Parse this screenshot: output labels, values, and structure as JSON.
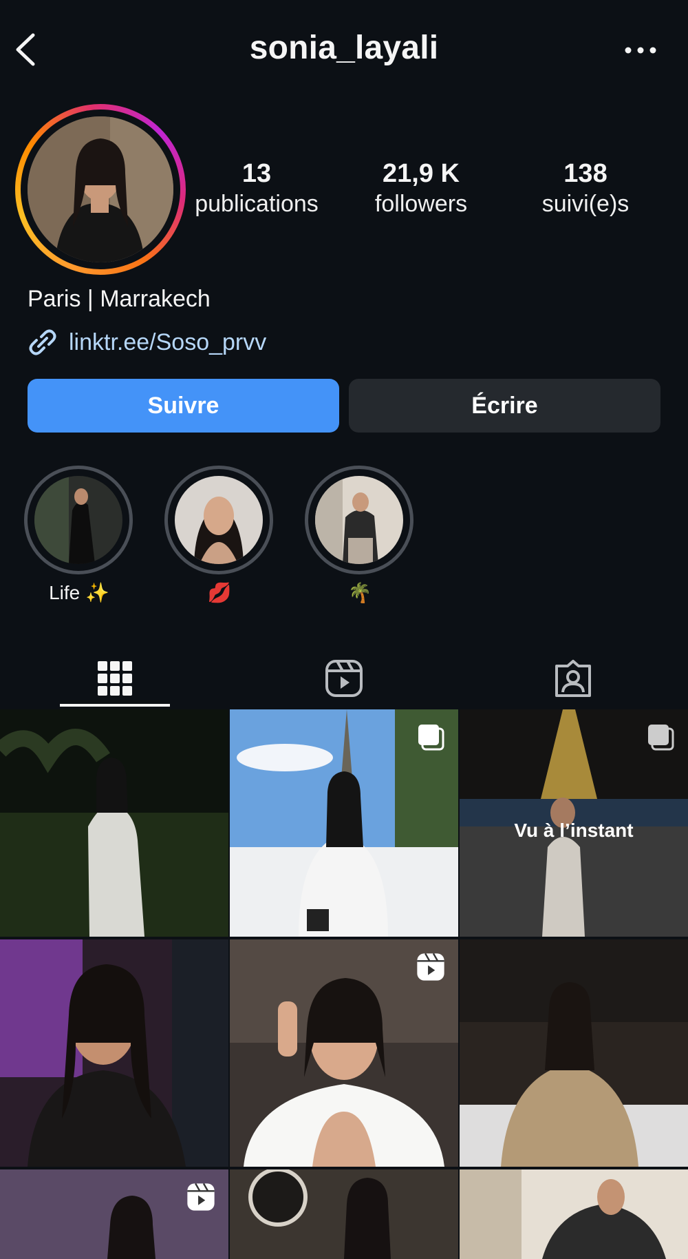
{
  "header": {
    "username": "sonia_layali",
    "back_icon": "chevron-left-icon",
    "more_icon": "ellipsis-icon"
  },
  "profile": {
    "stats": [
      {
        "value": "13",
        "label": "publications"
      },
      {
        "value": "21,9 K",
        "label": "followers"
      },
      {
        "value": "138",
        "label": "suivi(e)s"
      }
    ],
    "bio": "Paris | Marrakech",
    "link": "linktr.ee/Soso_prvv"
  },
  "actions": {
    "follow_label": "Suivre",
    "message_label": "Écrire"
  },
  "highlights": [
    {
      "label": "Life ✨"
    },
    {
      "label": "💋"
    },
    {
      "label": "🌴"
    }
  ],
  "tabs": [
    {
      "name": "grid",
      "icon": "grid-icon",
      "active": true
    },
    {
      "name": "reels",
      "icon": "reels-icon",
      "active": false
    },
    {
      "name": "tagged",
      "icon": "tagged-icon",
      "active": false
    }
  ],
  "posts": [
    {
      "type": "photo"
    },
    {
      "type": "carousel"
    },
    {
      "type": "carousel",
      "overlay_text": "Vu à l’instant"
    },
    {
      "type": "photo"
    },
    {
      "type": "reel"
    },
    {
      "type": "photo"
    },
    {
      "type": "reel"
    },
    {
      "type": "photo"
    },
    {
      "type": "photo"
    }
  ],
  "colors": {
    "background": "#0c1015",
    "follow_button": "#4493f8",
    "message_button": "#25292e",
    "link": "#b6d7f8"
  }
}
